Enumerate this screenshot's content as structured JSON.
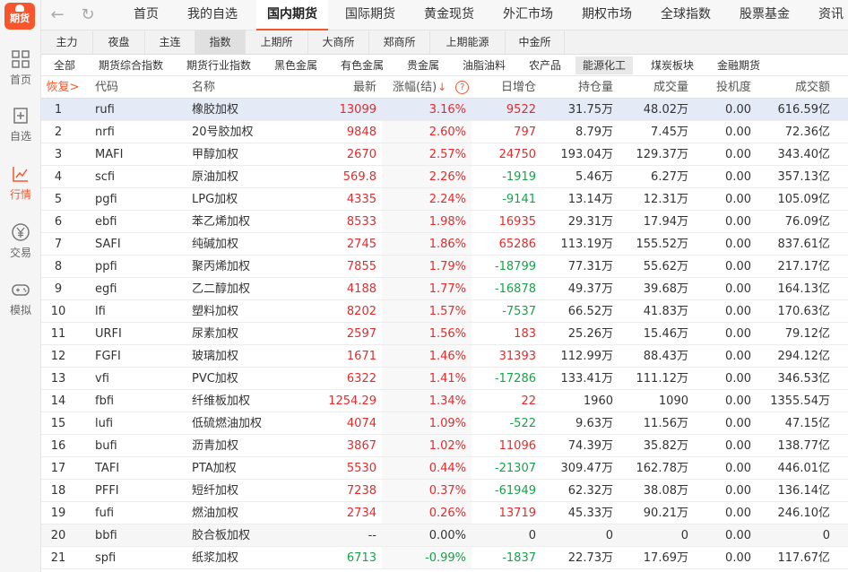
{
  "sidebar": {
    "logo_label": "期货",
    "items": [
      {
        "label": "首页",
        "icon": "grid-icon"
      },
      {
        "label": "自选",
        "icon": "plus-doc-icon"
      },
      {
        "label": "行情",
        "icon": "chart-icon",
        "active": true
      },
      {
        "label": "交易",
        "icon": "yen-icon"
      },
      {
        "label": "模拟",
        "icon": "gamepad-icon"
      }
    ]
  },
  "topnav": {
    "items": [
      "首页",
      "我的自选",
      "国内期货",
      "国际期货",
      "黄金现货",
      "外汇市场",
      "期权市场",
      "全球指数",
      "股票基金",
      "资讯中"
    ],
    "active_index": 2
  },
  "subtabs": {
    "items": [
      "主力",
      "夜盘",
      "主连",
      "指数",
      "上期所",
      "大商所",
      "郑商所",
      "上期能源",
      "中金所"
    ],
    "active_index": 3
  },
  "categories": {
    "items": [
      "全部",
      "期货综合指数",
      "期货行业指数",
      "黑色金属",
      "有色金属",
      "贵金属",
      "油脂油料",
      "农产品",
      "能源化工",
      "煤炭板块",
      "金融期货"
    ],
    "active_index": 8
  },
  "table": {
    "headers": {
      "restore": "恢复>",
      "code": "代码",
      "name": "名称",
      "last": "最新",
      "change": "涨幅(结)",
      "sort_icon": "↓",
      "help": "?",
      "daily_increase": "日增仓",
      "open_interest": "持仓量",
      "volume": "成交量",
      "speculation": "投机度",
      "amount": "成交额"
    },
    "rows": [
      {
        "idx": "1",
        "code": "rufi",
        "name": "橡胶加权",
        "last": "13099",
        "chg": "3.16%",
        "inc": "9522",
        "oi": "31.75万",
        "vol": "48.02万",
        "spec": "0.00",
        "amt": "616.59亿",
        "dir": "up",
        "incdir": "up"
      },
      {
        "idx": "2",
        "code": "nrfi",
        "name": "20号胶加权",
        "last": "9848",
        "chg": "2.60%",
        "inc": "797",
        "oi": "8.79万",
        "vol": "7.45万",
        "spec": "0.00",
        "amt": "72.36亿",
        "dir": "up",
        "incdir": "up"
      },
      {
        "idx": "3",
        "code": "MAFI",
        "name": "甲醇加权",
        "last": "2670",
        "chg": "2.57%",
        "inc": "24750",
        "oi": "193.04万",
        "vol": "129.37万",
        "spec": "0.00",
        "amt": "343.40亿",
        "dir": "up",
        "incdir": "up"
      },
      {
        "idx": "4",
        "code": "scfi",
        "name": "原油加权",
        "last": "569.8",
        "chg": "2.26%",
        "inc": "-1919",
        "oi": "5.46万",
        "vol": "6.27万",
        "spec": "0.00",
        "amt": "357.13亿",
        "dir": "up",
        "incdir": "down"
      },
      {
        "idx": "5",
        "code": "pgfi",
        "name": "LPG加权",
        "last": "4335",
        "chg": "2.24%",
        "inc": "-9141",
        "oi": "13.14万",
        "vol": "12.31万",
        "spec": "0.00",
        "amt": "105.09亿",
        "dir": "up",
        "incdir": "down"
      },
      {
        "idx": "6",
        "code": "ebfi",
        "name": "苯乙烯加权",
        "last": "8533",
        "chg": "1.98%",
        "inc": "16935",
        "oi": "29.31万",
        "vol": "17.94万",
        "spec": "0.00",
        "amt": "76.09亿",
        "dir": "up",
        "incdir": "up"
      },
      {
        "idx": "7",
        "code": "SAFI",
        "name": "纯碱加权",
        "last": "2745",
        "chg": "1.86%",
        "inc": "65286",
        "oi": "113.19万",
        "vol": "155.52万",
        "spec": "0.00",
        "amt": "837.61亿",
        "dir": "up",
        "incdir": "up"
      },
      {
        "idx": "8",
        "code": "ppfi",
        "name": "聚丙烯加权",
        "last": "7855",
        "chg": "1.79%",
        "inc": "-18799",
        "oi": "77.31万",
        "vol": "55.62万",
        "spec": "0.00",
        "amt": "217.17亿",
        "dir": "up",
        "incdir": "down"
      },
      {
        "idx": "9",
        "code": "egfi",
        "name": "乙二醇加权",
        "last": "4188",
        "chg": "1.77%",
        "inc": "-16878",
        "oi": "49.37万",
        "vol": "39.68万",
        "spec": "0.00",
        "amt": "164.13亿",
        "dir": "up",
        "incdir": "down"
      },
      {
        "idx": "10",
        "code": "lfi",
        "name": "塑料加权",
        "last": "8202",
        "chg": "1.57%",
        "inc": "-7537",
        "oi": "66.52万",
        "vol": "41.83万",
        "spec": "0.00",
        "amt": "170.63亿",
        "dir": "up",
        "incdir": "down"
      },
      {
        "idx": "11",
        "code": "URFI",
        "name": "尿素加权",
        "last": "2597",
        "chg": "1.56%",
        "inc": "183",
        "oi": "25.26万",
        "vol": "15.46万",
        "spec": "0.00",
        "amt": "79.12亿",
        "dir": "up",
        "incdir": "up"
      },
      {
        "idx": "12",
        "code": "FGFI",
        "name": "玻璃加权",
        "last": "1671",
        "chg": "1.46%",
        "inc": "31393",
        "oi": "112.99万",
        "vol": "88.43万",
        "spec": "0.00",
        "amt": "294.12亿",
        "dir": "up",
        "incdir": "up"
      },
      {
        "idx": "13",
        "code": "vfi",
        "name": "PVC加权",
        "last": "6322",
        "chg": "1.41%",
        "inc": "-17286",
        "oi": "133.41万",
        "vol": "111.12万",
        "spec": "0.00",
        "amt": "346.53亿",
        "dir": "up",
        "incdir": "down"
      },
      {
        "idx": "14",
        "code": "fbfi",
        "name": "纤维板加权",
        "last": "1254.29",
        "chg": "1.34%",
        "inc": "22",
        "oi": "1960",
        "vol": "1090",
        "spec": "0.00",
        "amt": "1355.54万",
        "dir": "up",
        "incdir": "up"
      },
      {
        "idx": "15",
        "code": "lufi",
        "name": "低硫燃油加权",
        "last": "4074",
        "chg": "1.09%",
        "inc": "-522",
        "oi": "9.63万",
        "vol": "11.56万",
        "spec": "0.00",
        "amt": "47.15亿",
        "dir": "up",
        "incdir": "down"
      },
      {
        "idx": "16",
        "code": "bufi",
        "name": "沥青加权",
        "last": "3867",
        "chg": "1.02%",
        "inc": "11096",
        "oi": "74.39万",
        "vol": "35.82万",
        "spec": "0.00",
        "amt": "138.77亿",
        "dir": "up",
        "incdir": "up"
      },
      {
        "idx": "17",
        "code": "TAFI",
        "name": "PTA加权",
        "last": "5530",
        "chg": "0.44%",
        "inc": "-21307",
        "oi": "309.47万",
        "vol": "162.78万",
        "spec": "0.00",
        "amt": "446.01亿",
        "dir": "up",
        "incdir": "down"
      },
      {
        "idx": "18",
        "code": "PFFI",
        "name": "短纤加权",
        "last": "7238",
        "chg": "0.37%",
        "inc": "-61949",
        "oi": "62.32万",
        "vol": "38.08万",
        "spec": "0.00",
        "amt": "136.14亿",
        "dir": "up",
        "incdir": "down"
      },
      {
        "idx": "19",
        "code": "fufi",
        "name": "燃油加权",
        "last": "2734",
        "chg": "0.26%",
        "inc": "13719",
        "oi": "45.33万",
        "vol": "90.21万",
        "spec": "0.00",
        "amt": "246.10亿",
        "dir": "up",
        "incdir": "up"
      },
      {
        "idx": "20",
        "code": "bbfi",
        "name": "胶合板加权",
        "last": "--",
        "chg": "0.00%",
        "inc": "0",
        "oi": "0",
        "vol": "0",
        "spec": "0.00",
        "amt": "0",
        "dir": "flat",
        "incdir": "flat"
      },
      {
        "idx": "21",
        "code": "spfi",
        "name": "纸浆加权",
        "last": "6713",
        "chg": "-0.99%",
        "inc": "-1837",
        "oi": "22.73万",
        "vol": "17.69万",
        "spec": "0.00",
        "amt": "117.67亿",
        "dir": "down",
        "incdir": "down"
      }
    ],
    "selected_index": 0
  },
  "colors": {
    "accent": "#f7562c",
    "up": "#e12c2c",
    "down": "#16a34a"
  }
}
